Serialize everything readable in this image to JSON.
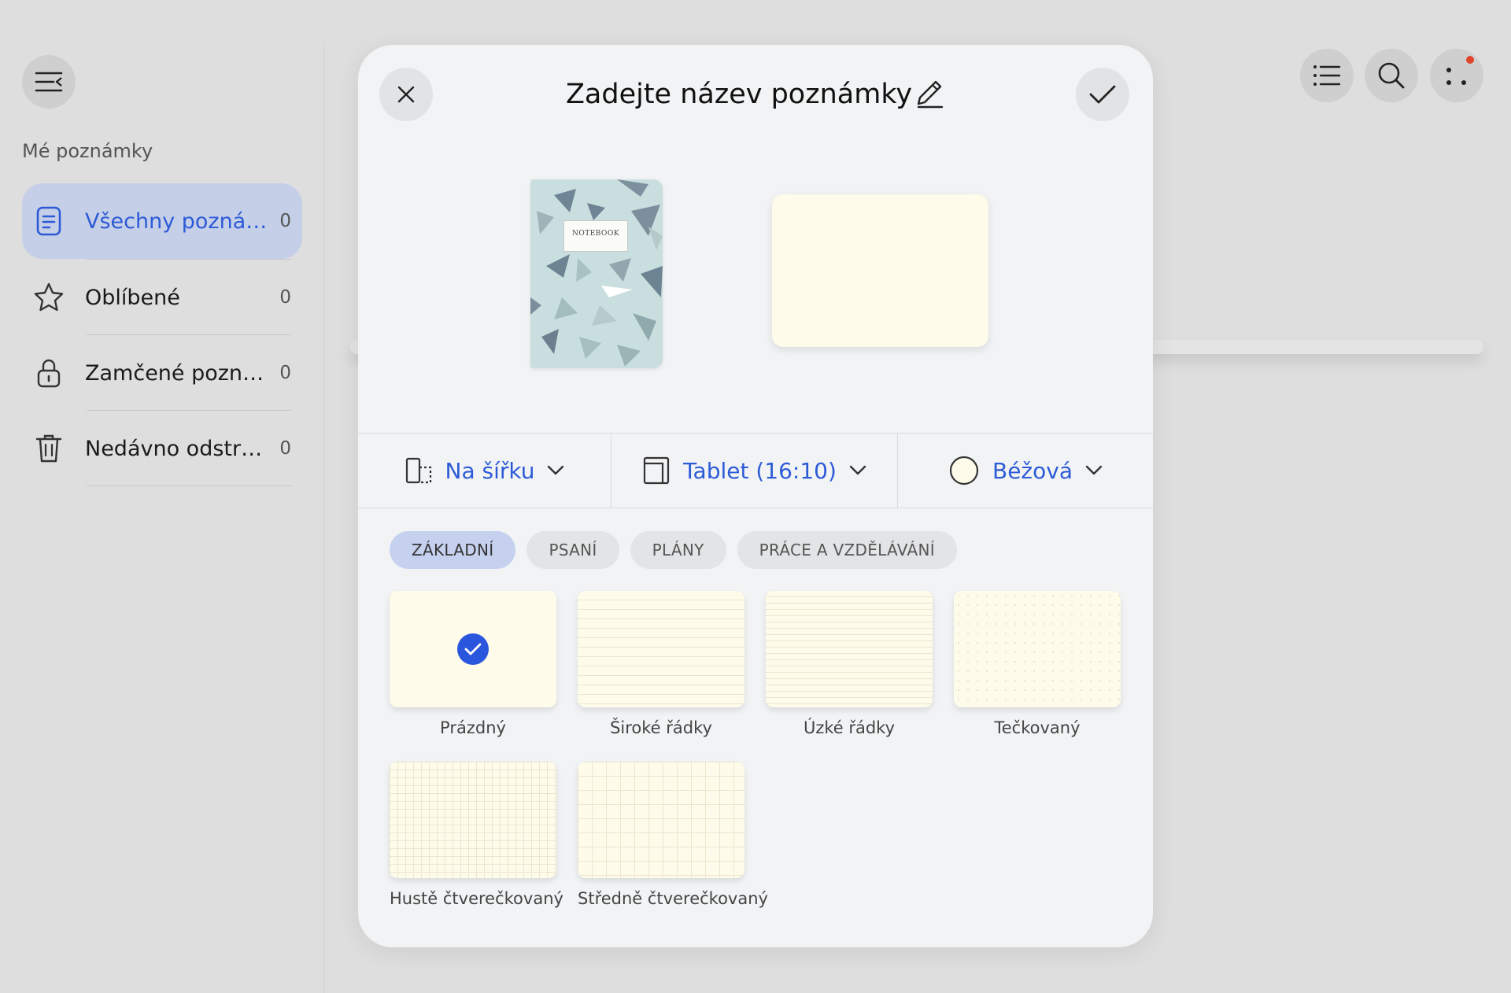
{
  "sidebar": {
    "section_title": "Mé poznámky",
    "items": [
      {
        "label": "Všechny pozná…",
        "count": "0",
        "icon": "note-icon"
      },
      {
        "label": "Oblíbené",
        "count": "0",
        "icon": "star-icon"
      },
      {
        "label": "Zamčené pozná…",
        "count": "0",
        "icon": "lock-icon"
      },
      {
        "label": "Nedávno odstra…",
        "count": "0",
        "icon": "trash-icon"
      }
    ]
  },
  "toolbar": {
    "icons": [
      "list-icon",
      "search-icon",
      "more-icon"
    ]
  },
  "dialog": {
    "title": "Zadejte název poznámky",
    "cover_text": "NOTEBOOK",
    "settings": {
      "orientation": "Na šířku",
      "size": "Tablet (16:10)",
      "color": "Béžová"
    },
    "tabs": [
      "ZÁKLADNÍ",
      "PSANÍ",
      "PLÁNY",
      "PRÁCE A VZDĚLÁVÁNÍ"
    ],
    "templates": [
      {
        "name": "Prázdný",
        "selected": true
      },
      {
        "name": "Široké řádky"
      },
      {
        "name": "Úzké řádky"
      },
      {
        "name": "Tečkovaný"
      },
      {
        "name": "Hustě čtverečkovaný"
      },
      {
        "name": "Středně čtverečkovaný"
      }
    ]
  },
  "colors": {
    "accent": "#2d5bd7",
    "active_nav_bg": "#c5cfe8",
    "page_beige": "#fefbea",
    "notification": "#e0452b"
  }
}
